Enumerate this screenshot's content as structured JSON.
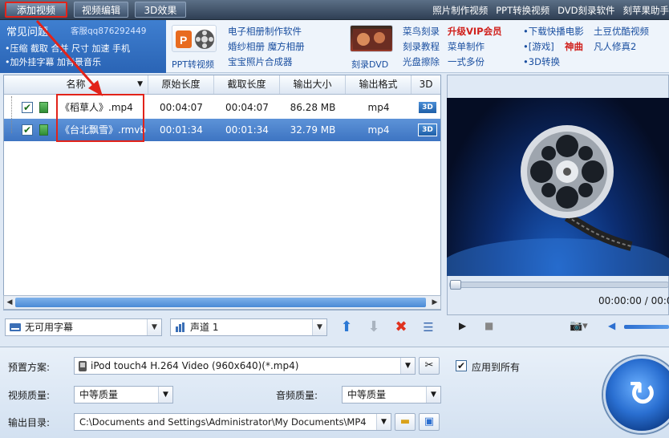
{
  "toolbar": {
    "add_video": "添加视频",
    "video_edit": "视频编辑",
    "effect_3d": "3D效果",
    "links": [
      "照片制作视频",
      "PPT转换视频",
      "DVD刻录软件",
      "刻苹果助手"
    ]
  },
  "promo": {
    "faq_title": "常见问题",
    "qq": "客服qq876292449",
    "faq_line1": "•压缩 截取 合并 尺寸 加速 手机",
    "faq_line2": "•加外挂字幕 加背景音乐",
    "ppt_caption": "PPT转视频",
    "ppt_links": [
      "电子相册制作软件",
      "婚纱相册 魔方相册",
      "宝宝照片合成器"
    ],
    "dvd_caption": "刻录DVD",
    "dvd_links": [
      "菜鸟刻录",
      "升级VIP会员",
      "刻录教程",
      "菜单制作",
      "光盘擦除",
      "一式多份"
    ],
    "right_links": [
      "•下载快播电影",
      "土豆优酷视频",
      "•[游戏]",
      "神曲",
      "凡人修真2",
      "•3D转换"
    ]
  },
  "file_list": {
    "columns": [
      "名称",
      "原始长度",
      "截取长度",
      "输出大小",
      "输出格式",
      "3D"
    ],
    "rows": [
      {
        "name": "《稻草人》.mp4",
        "orig_len": "00:04:07",
        "cut_len": "00:04:07",
        "size": "86.28 MB",
        "format": "mp4",
        "badge": "3D"
      },
      {
        "name": "《台北飘雪》.rmvb",
        "orig_len": "00:01:34",
        "cut_len": "00:01:34",
        "size": "32.79 MB",
        "format": "mp4",
        "badge": "3D"
      }
    ]
  },
  "controls": {
    "subtitle": "无可用字幕",
    "audio_track": "声道 1"
  },
  "preview": {
    "time": "00:00:00 / 00:0"
  },
  "settings": {
    "preset_label": "预置方案:",
    "preset_value": "iPod touch4 H.264 Video (960x640)(*.mp4)",
    "apply_all": "应用到所有",
    "video_quality_label": "视频质量:",
    "video_quality": "中等质量",
    "audio_quality_label": "音频质量:",
    "audio_quality": "中等质量",
    "output_dir_label": "输出目录:",
    "output_dir": "C:\\Documents and Settings\\Administrator\\My Documents\\MP4"
  }
}
